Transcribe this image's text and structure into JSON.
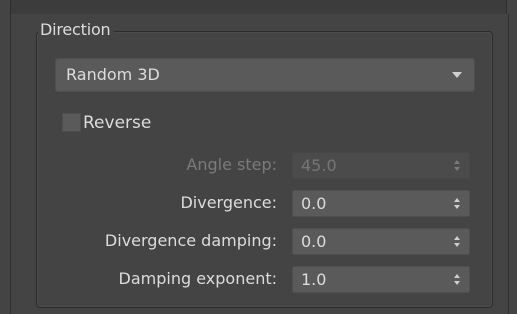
{
  "group": {
    "title": "Direction"
  },
  "direction_dropdown": {
    "selected": "Random 3D"
  },
  "reverse_checkbox": {
    "label": "Reverse",
    "checked": false
  },
  "params": [
    {
      "label": "Angle step:",
      "value": "45.0",
      "enabled": false
    },
    {
      "label": "Divergence:",
      "value": "0.0",
      "enabled": true
    },
    {
      "label": "Divergence damping:",
      "value": "0.0",
      "enabled": true
    },
    {
      "label": "Damping exponent:",
      "value": "1.0",
      "enabled": true
    }
  ],
  "icons": {
    "dropdown": "chevron-down-icon",
    "spinner": "spinner-arrows-icon"
  }
}
